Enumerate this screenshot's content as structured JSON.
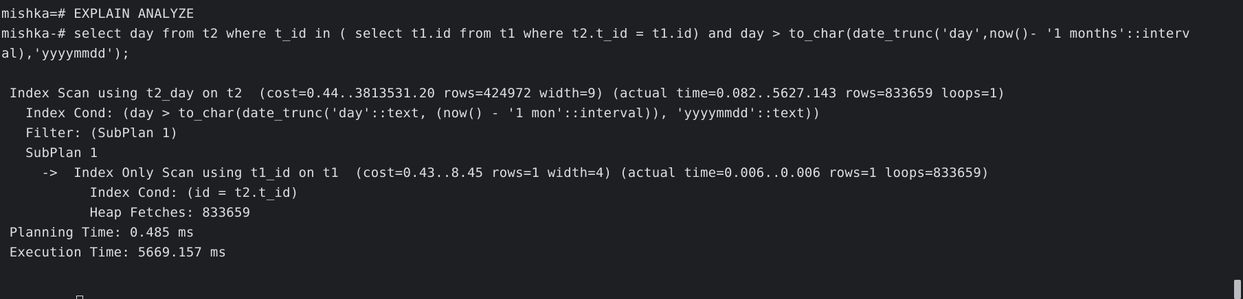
{
  "terminal": {
    "lines": [
      "mishka=# EXPLAIN ANALYZE",
      "mishka-# select day from t2 where t_id in ( select t1.id from t1 where t2.t_id = t1.id) and day > to_char(date_trunc('day',now()- '1 months'::interv",
      "al),'yyyymmdd');",
      "",
      " Index Scan using t2_day on t2  (cost=0.44..3813531.20 rows=424972 width=9) (actual time=0.082..5627.143 rows=833659 loops=1)",
      "   Index Cond: (day > to_char(date_trunc('day'::text, (now() - '1 mon'::interval)), 'yyyymmdd'::text))",
      "   Filter: (SubPlan 1)",
      "   SubPlan 1",
      "     ->  Index Only Scan using t1_id on t1  (cost=0.43..8.45 rows=1 width=4) (actual time=0.006..0.006 rows=1 loops=833659)",
      "           Index Cond: (id = t2.t_id)",
      "           Heap Fetches: 833659",
      " Planning Time: 0.485 ms",
      " Execution Time: 5669.157 ms"
    ]
  },
  "colors": {
    "background": "#1e1f22",
    "text": "#dcdfe4",
    "scrollbar_thumb": "#b9bcc2"
  },
  "icons": {
    "cursor": "text-cursor-icon"
  }
}
